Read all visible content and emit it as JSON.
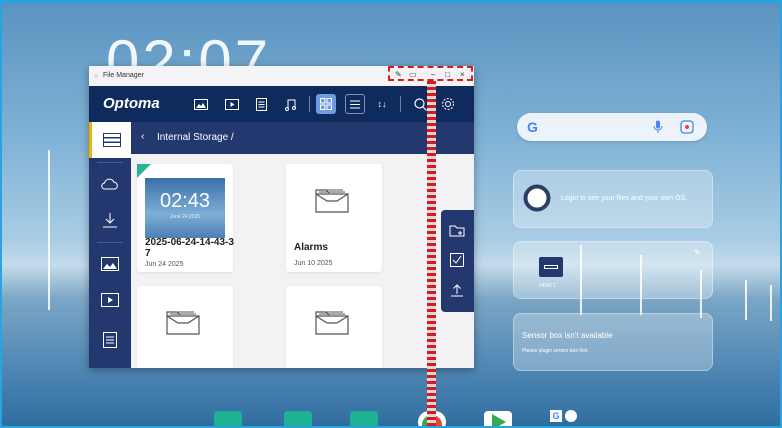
{
  "desktop": {
    "clock_ghost": "02:07"
  },
  "file_manager": {
    "title": "File Manager",
    "brand": "Optoma",
    "breadcrumb": "Internal Storage /",
    "items": [
      {
        "name": "2025-06-24-14-43-3\n7",
        "date": "Jun 24 2025",
        "thumb_time": "02:43",
        "thumb_date": "June 24,2025",
        "type": "image"
      },
      {
        "name": "Alarms",
        "date": "Jun 10 2025",
        "type": "folder"
      },
      {
        "name": "",
        "date": "",
        "type": "folder"
      },
      {
        "name": "",
        "date": "",
        "type": "folder"
      }
    ]
  },
  "widgets": {
    "login_text": "Login to see your files and your own OS.",
    "hdmi_label": "HDMI 1",
    "sensor_title": "Sensor box isn't available",
    "sensor_sub": "Please plugin sensor box first."
  },
  "colors": {
    "toolbar": "#0f2a5c",
    "sidebar": "#22386f",
    "accent_blue": "#6f9be0",
    "selection_red": "#d8191f",
    "screen_border": "#2aa4e0"
  }
}
